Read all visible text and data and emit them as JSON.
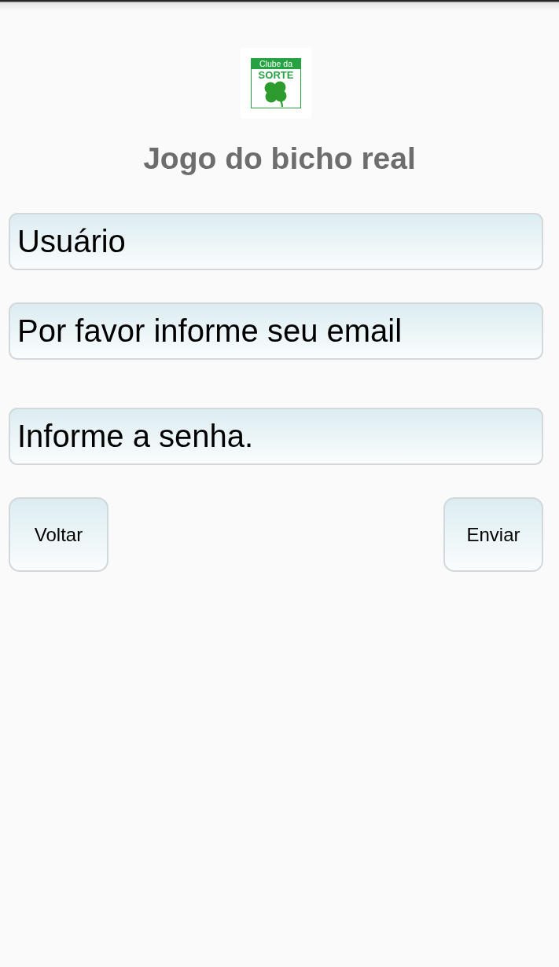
{
  "logo": {
    "line_1": "Clube da",
    "line_2": "SORTE"
  },
  "title": "Jogo do bicho real",
  "fields": [
    {
      "placeholder": "Usuário"
    },
    {
      "placeholder": "Por favor informe seu email"
    },
    {
      "placeholder": "Informe a senha."
    }
  ],
  "buttons": [
    "Voltar",
    "Enviar"
  ]
}
